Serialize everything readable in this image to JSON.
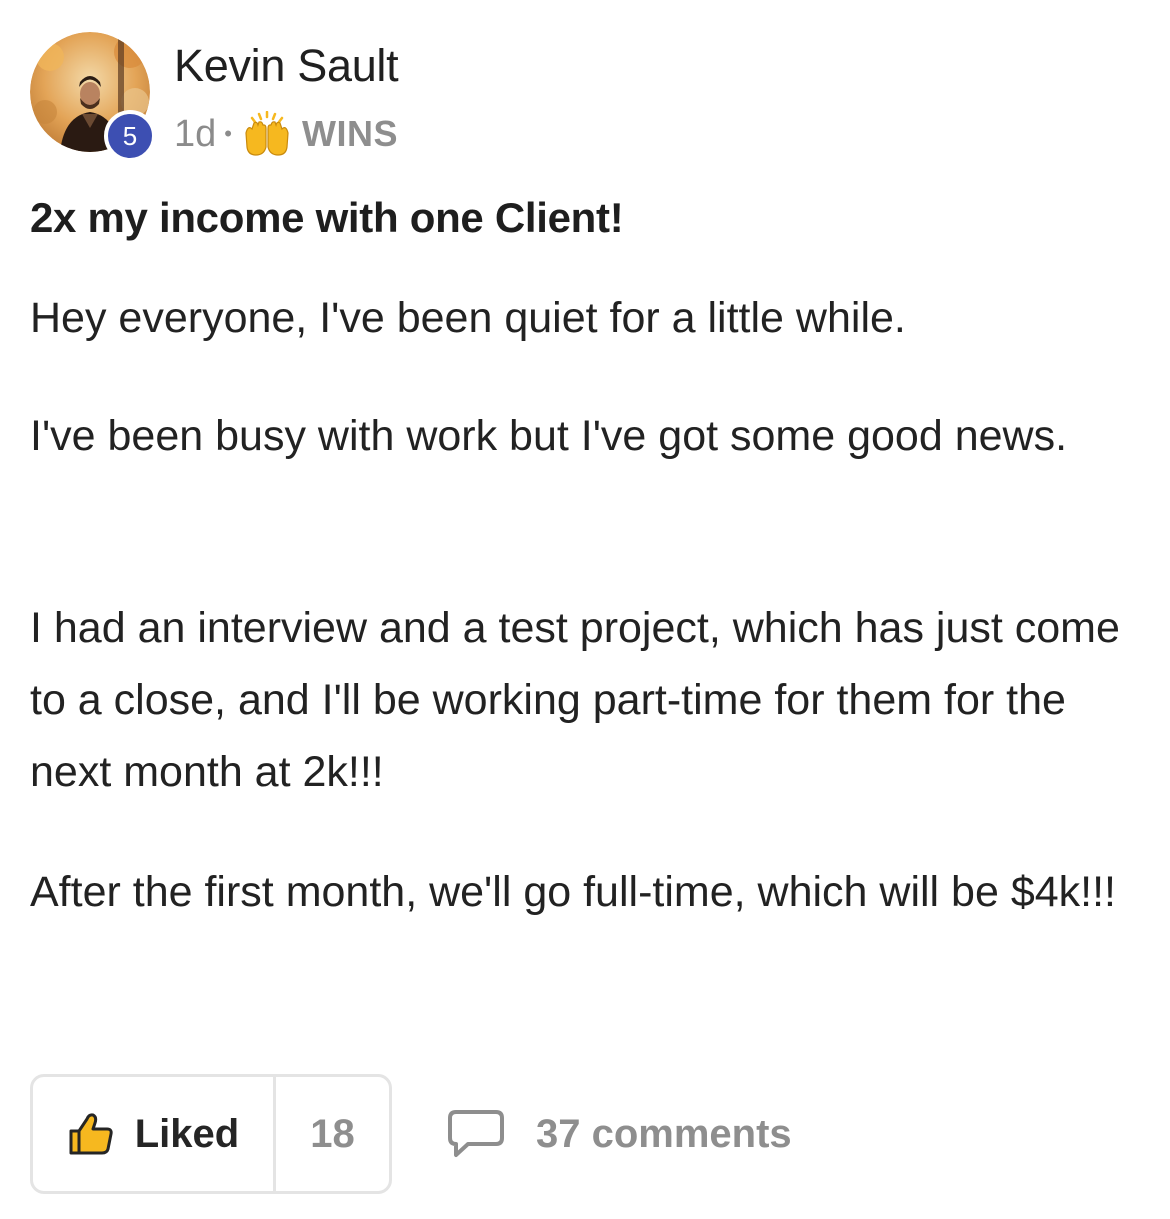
{
  "author": {
    "name": "Kevin Sault",
    "level": "5",
    "avatar_icon": "profile-photo"
  },
  "meta": {
    "time": "1d",
    "separator": "•",
    "category_icon": "raising-hands-emoji",
    "category": "WINS"
  },
  "post": {
    "title": "2x my income with one Client!",
    "paragraphs": [
      "Hey everyone, I've been quiet for a little while.",
      "I've been busy with work but I've got some good news.",
      "I had an interview and a test project, which has just come to a close, and I'll be working part-time for them for the next month at 2k!!!",
      "After the first month, we'll go full-time, which will be $4k!!!"
    ]
  },
  "actions": {
    "like_label": "Liked",
    "like_count": "18",
    "comments_label": "37 comments",
    "like_icon": "thumbs-up-icon",
    "comment_icon": "speech-bubble-icon"
  },
  "colors": {
    "badge": "#3d4fb2",
    "muted_text": "#8e8e8e",
    "border": "#e4e4e4",
    "emoji_yellow": "#f6b81f"
  }
}
